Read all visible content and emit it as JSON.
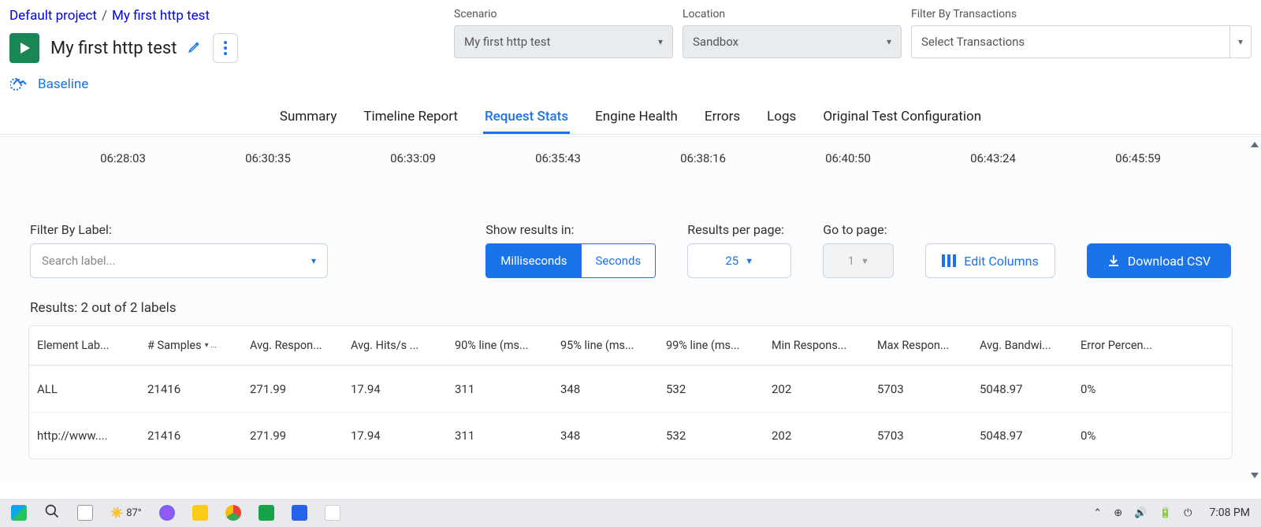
{
  "breadcrumb": {
    "project": "Default project",
    "test": "My first http test"
  },
  "title": "My first http test",
  "baseline_label": "Baseline",
  "filters": {
    "scenario": {
      "label": "Scenario",
      "value": "My first http test"
    },
    "location": {
      "label": "Location",
      "value": "Sandbox"
    },
    "transactions": {
      "label": "Filter By Transactions",
      "placeholder": "Select Transactions"
    }
  },
  "tabs": [
    "Summary",
    "Timeline Report",
    "Request Stats",
    "Engine Health",
    "Errors",
    "Logs",
    "Original Test Configuration"
  ],
  "active_tab": "Request Stats",
  "timeline": [
    "06:28:03",
    "06:30:35",
    "06:33:09",
    "06:35:43",
    "06:38:16",
    "06:40:50",
    "06:43:24",
    "06:45:59"
  ],
  "controls": {
    "filter_label_title": "Filter By Label:",
    "filter_label_placeholder": "Search label...",
    "show_results_title": "Show results in:",
    "unit_ms": "Milliseconds",
    "unit_s": "Seconds",
    "rpp_title": "Results per page:",
    "rpp_value": "25",
    "goto_title": "Go to page:",
    "goto_value": "1",
    "edit_columns": "Edit Columns",
    "download_csv": "Download CSV"
  },
  "results_count": "Results: 2 out of 2 labels",
  "columns": [
    "Element Lab...",
    "# Samples",
    "Avg. Respon...",
    "Avg. Hits/s ...",
    "90% line (ms...",
    "95% line (ms...",
    "99% line (ms...",
    "Min Respons...",
    "Max Respon...",
    "Avg. Bandwi...",
    "Error Percen..."
  ],
  "sort_icon": "▾ ...",
  "rows": [
    {
      "label": "ALL",
      "samples": "21416",
      "avg_resp": "271.99",
      "hits": "17.94",
      "p90": "311",
      "p95": "348",
      "p99": "532",
      "min": "202",
      "max": "5703",
      "bw": "5048.97",
      "err": "0%"
    },
    {
      "label": "http://www....",
      "samples": "21416",
      "avg_resp": "271.99",
      "hits": "17.94",
      "p90": "311",
      "p95": "348",
      "p99": "532",
      "min": "202",
      "max": "5703",
      "bw": "5048.97",
      "err": "0%"
    }
  ],
  "taskbar": {
    "temp": "87°",
    "clock": "7:08 PM"
  }
}
